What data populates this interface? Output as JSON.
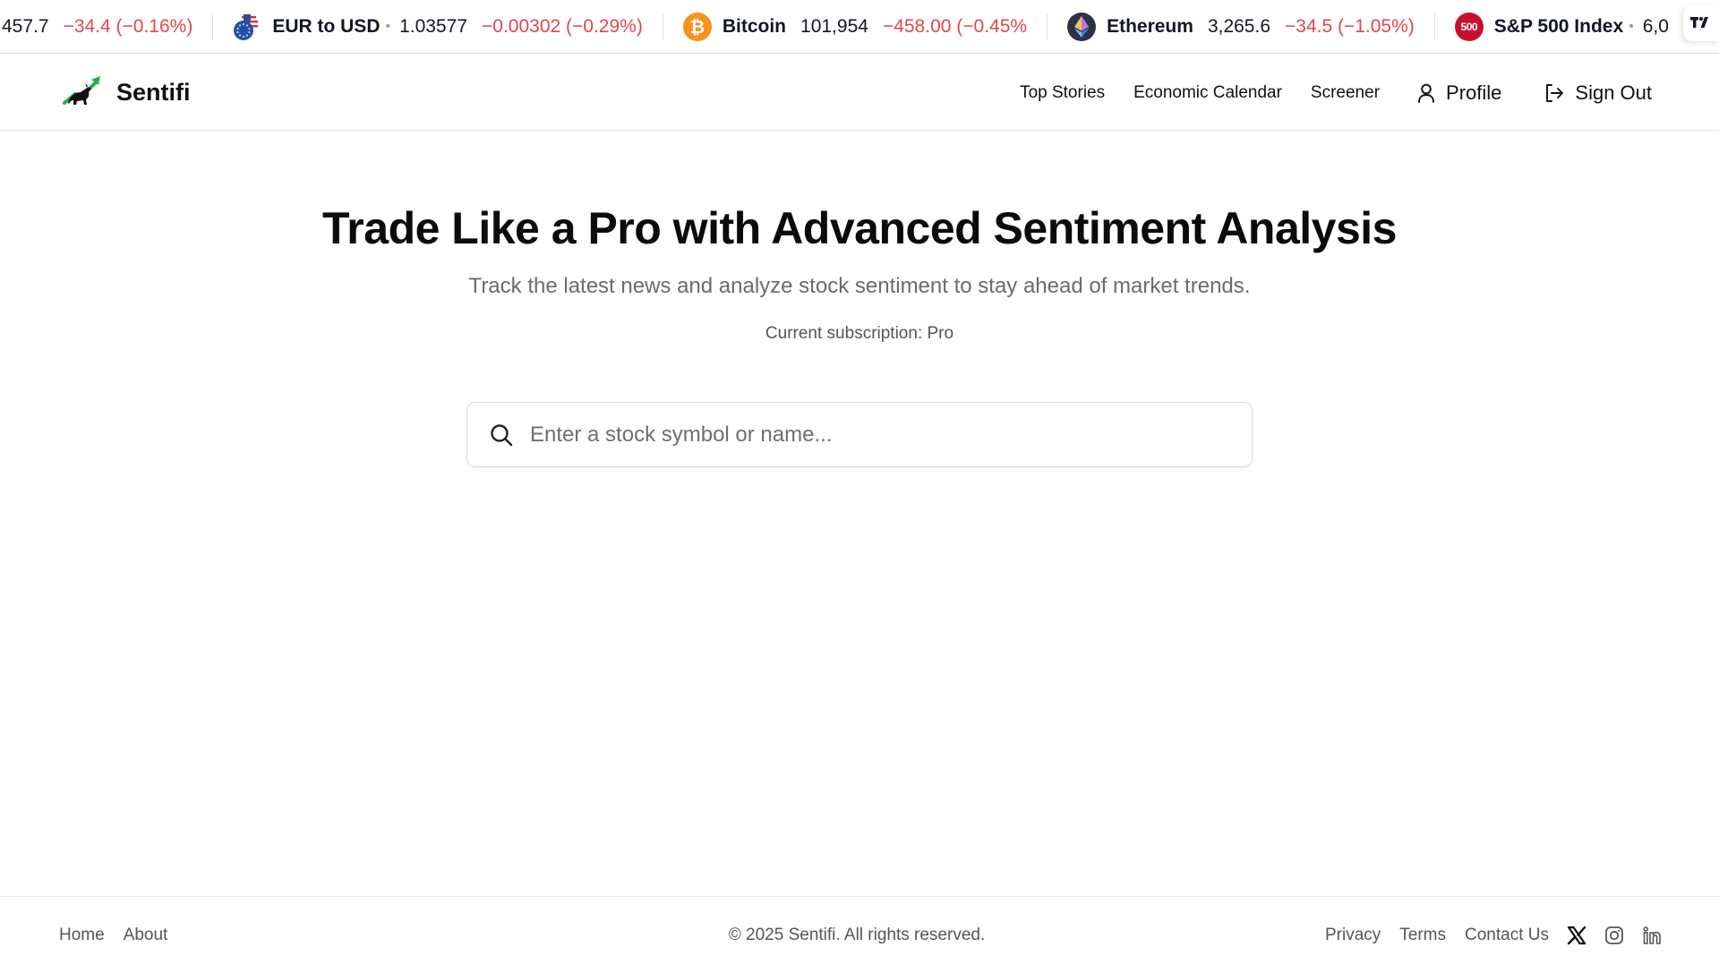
{
  "ticker": {
    "items": [
      {
        "name": "",
        "price": "457.7",
        "change": "−34.4 (−0.16%)",
        "icon": "none"
      },
      {
        "name": "EUR to USD",
        "price": "1.03577",
        "change": "−0.00302 (−0.29%)",
        "icon": "eur-usd-flag-icon",
        "dot": "•"
      },
      {
        "name": "Bitcoin",
        "price": "101,954",
        "change": "−458.00 (−0.45%",
        "icon": "bitcoin-icon"
      },
      {
        "name": "Ethereum",
        "price": "3,265.6",
        "change": "−34.5 (−1.05%)",
        "icon": "ethereum-icon"
      },
      {
        "name": "S&P 500 Index",
        "price": "6,0",
        "change": "",
        "icon": "sp500-icon",
        "icon_text": "500",
        "dot": "•"
      }
    ],
    "badge_icon": "tradingview-icon",
    "negative_color": "#e0474c"
  },
  "header": {
    "brand_name": "Sentifi",
    "brand_icon": "bull-chart-logo-icon",
    "nav": {
      "top_stories": "Top Stories",
      "economic_calendar": "Economic Calendar",
      "screener": "Screener",
      "profile": "Profile",
      "sign_out": "Sign Out"
    }
  },
  "hero": {
    "title": "Trade Like a Pro with Advanced Sentiment Analysis",
    "subtitle": "Track the latest news and analyze stock sentiment to stay ahead of market trends.",
    "subscription": "Current subscription: Pro"
  },
  "search": {
    "placeholder": "Enter a stock symbol or name...",
    "value": ""
  },
  "footer": {
    "home": "Home",
    "about": "About",
    "copyright": "© 2025 Sentifi. All rights reserved.",
    "privacy": "Privacy",
    "terms": "Terms",
    "contact": "Contact Us",
    "social_icons": [
      "x-icon",
      "instagram-icon",
      "linkedin-icon"
    ]
  },
  "colors": {
    "accent_green": "#2da84a",
    "bitcoin_orange": "#f7931a",
    "ethereum_dark": "#2f3246",
    "sp500_red": "#c8102e"
  }
}
